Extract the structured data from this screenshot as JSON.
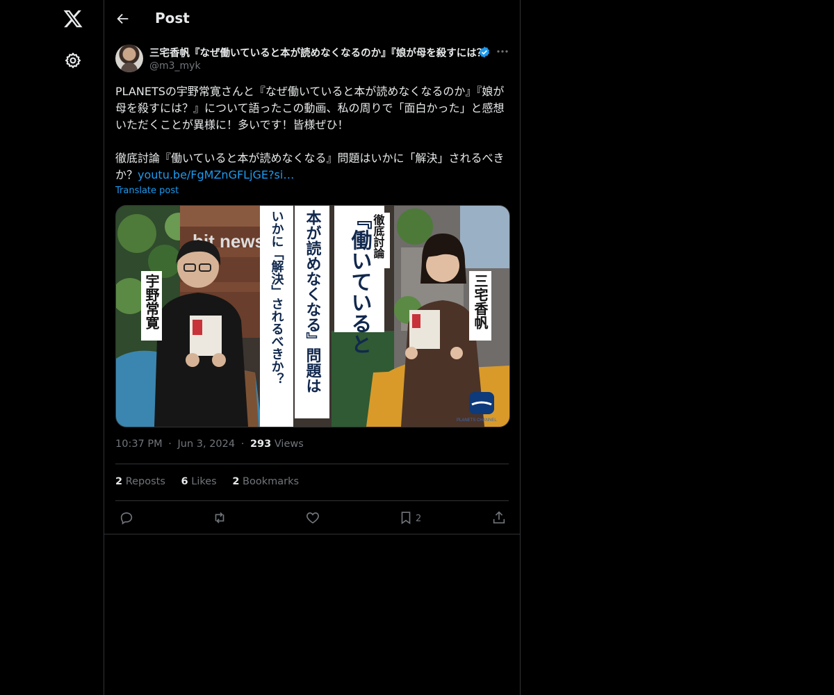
{
  "header": {
    "title": "Post"
  },
  "author": {
    "display_name": "三宅香帆『なぜ働いていると本が読めなくなるのか』『娘が母を殺すには？』",
    "handle": "@m3_myk"
  },
  "post": {
    "text_1": "PLANETSの宇野常寛さんと『なぜ働いていると本が読めなくなるのか』『娘が母を殺すには？』について語ったこの動画、私の周りで「面白かった」と感想いただくことが異様に！多いです！皆様ぜひ！",
    "text_2": "徹底討論『働いていると本が読めなくなる』問題はいかに「解決」されるべきか？",
    "link": "youtu.be/FgMZnGFLjGE?si…",
    "translate_label": "Translate post"
  },
  "media": {
    "caption_sub": "徹底討論",
    "caption_1": "『働いていると",
    "caption_2": "本が読めなくなる』問題は",
    "caption_3": "いかに「解決」されるべきか？",
    "name_left": "宇野常寛",
    "name_right": "三宅香帆",
    "sign_text": "bit news",
    "channel_mark": "PLANETS CHANNEL"
  },
  "meta": {
    "time": "10:37 PM",
    "date": "Jun 3, 2024",
    "views_count": "293",
    "views_label": "Views"
  },
  "stats": {
    "reposts_count": "2",
    "reposts_label": "Reposts",
    "likes_count": "6",
    "likes_label": "Likes",
    "bookmarks_count": "2",
    "bookmarks_label": "Bookmarks"
  },
  "actions": {
    "bookmark_count": "2"
  },
  "icons": [
    "x-logo-icon",
    "gear-icon",
    "back-arrow-icon",
    "verified-badge-icon",
    "more-icon",
    "reply-icon",
    "repost-icon",
    "like-icon",
    "bookmark-icon",
    "share-icon"
  ],
  "colors": {
    "background": "#000000",
    "text": "#e7e9ea",
    "muted": "#71767b",
    "accent": "#1d9bf0",
    "border": "#2f3336"
  }
}
